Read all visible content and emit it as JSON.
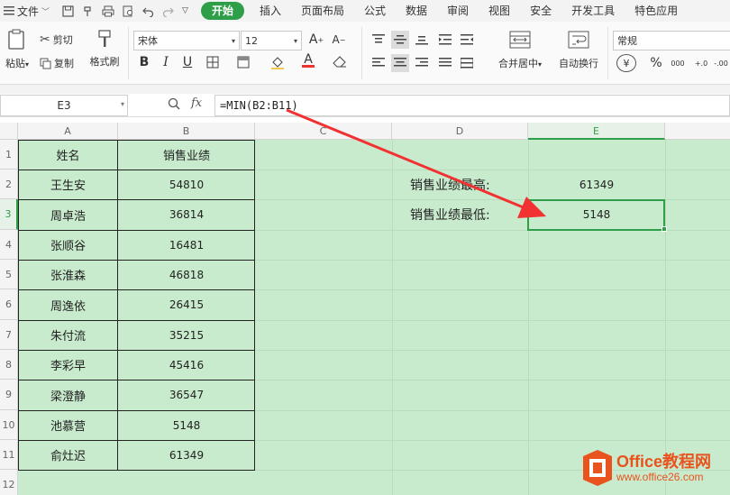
{
  "menu": {
    "file_label": "文件",
    "tabs": [
      "开始",
      "插入",
      "页面布局",
      "公式",
      "数据",
      "审阅",
      "视图",
      "安全",
      "开发工具",
      "特色应用"
    ],
    "active_tab": "开始"
  },
  "ribbon": {
    "paste": "粘贴",
    "cut": "剪切",
    "copy": "复制",
    "format_painter": "格式刷",
    "font_name": "宋体",
    "font_size": "12",
    "bold": "B",
    "italic": "I",
    "underline": "U",
    "merge_center": "合并居中",
    "wrap_text": "自动换行",
    "number_format": "常规",
    "percent": "%",
    "thousands": "000",
    "dec_inc": "+.0",
    "dec_dec": "-.00",
    "currency": "¥"
  },
  "formula_bar": {
    "name_box": "E3",
    "fx": "fx",
    "formula": "=MIN(B2:B11)"
  },
  "sheet": {
    "columns": [
      "A",
      "B",
      "C",
      "D",
      "E"
    ],
    "rows": [
      "1",
      "2",
      "3",
      "4",
      "5",
      "6",
      "7",
      "8",
      "9",
      "10",
      "11",
      "12"
    ],
    "header": {
      "name": "姓名",
      "sales": "销售业绩"
    },
    "records": [
      {
        "name": "王生安",
        "sales": "54810"
      },
      {
        "name": "周卓浩",
        "sales": "36814"
      },
      {
        "name": "张顺谷",
        "sales": "16481"
      },
      {
        "name": "张淮森",
        "sales": "46818"
      },
      {
        "name": "周逸依",
        "sales": "26415"
      },
      {
        "name": "朱付流",
        "sales": "35215"
      },
      {
        "name": "李彩早",
        "sales": "45416"
      },
      {
        "name": "梁澄静",
        "sales": "36547"
      },
      {
        "name": "池慕营",
        "sales": "5148"
      },
      {
        "name": "俞灶迟",
        "sales": "61349"
      }
    ],
    "summary": [
      {
        "label": "销售业绩最高:",
        "value": "61349"
      },
      {
        "label": "销售业绩最低:",
        "value": "5148"
      }
    ],
    "selected_cell": "E3"
  },
  "watermark": {
    "brand": "Office教程网",
    "url": "www.office26.com"
  },
  "colors": {
    "accent": "#2f9e48",
    "sheet_bg": "#c9ebcd",
    "arrow": "#f23232",
    "watermark": "#e8531e"
  }
}
